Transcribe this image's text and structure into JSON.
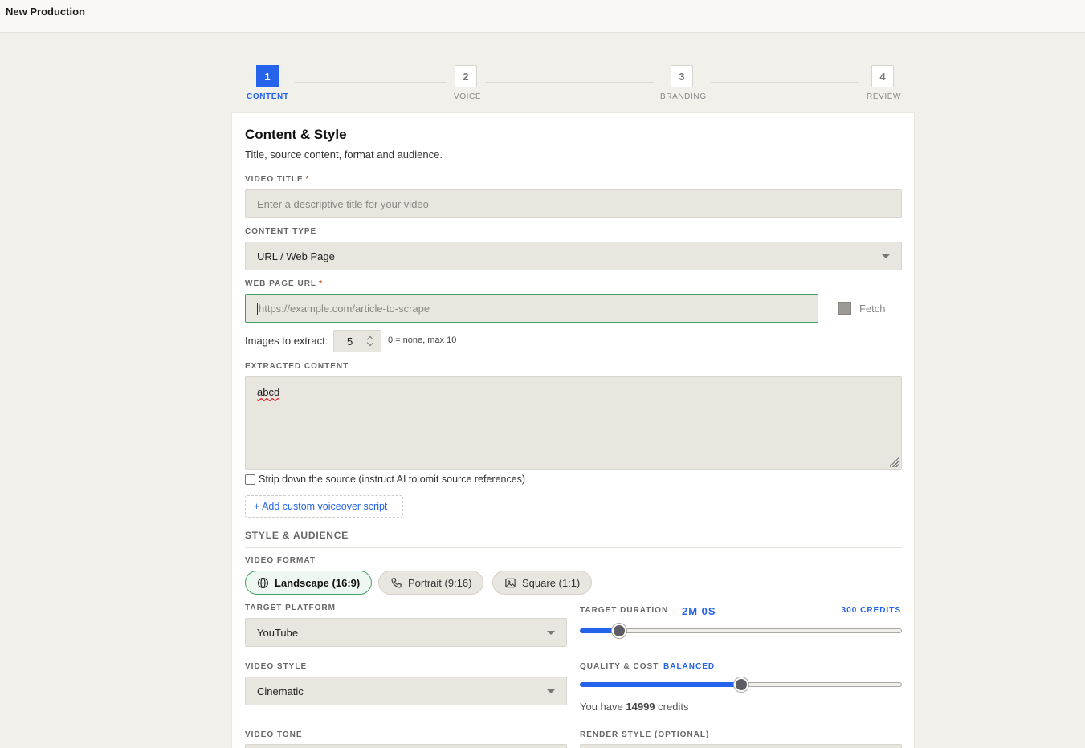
{
  "app": {
    "title": "New Production"
  },
  "stepper": {
    "steps": [
      {
        "number": "1",
        "label": "CONTENT"
      },
      {
        "number": "2",
        "label": "VOICE"
      },
      {
        "number": "3",
        "label": "BRANDING"
      },
      {
        "number": "4",
        "label": "REVIEW"
      }
    ],
    "active_index": 0
  },
  "content": {
    "heading": "Content & Style",
    "subheading": "Title, source content, format and audience.",
    "video_title": {
      "label": "VIDEO TITLE",
      "required_mark": "*",
      "value": "",
      "placeholder": "Enter a descriptive title for your video"
    },
    "content_type": {
      "label": "CONTENT TYPE",
      "value": "URL / Web Page"
    },
    "web_page_url": {
      "label": "WEB PAGE URL",
      "required_mark": "*",
      "value": "",
      "placeholder": "https://example.com/article-to-scrape",
      "fetch_label": "Fetch"
    },
    "images_to_extract": {
      "label": "Images to extract:",
      "value": "5",
      "hint": "0 = none, max 10"
    },
    "extracted_content": {
      "label": "EXTRACTED CONTENT",
      "value": "abcd"
    },
    "strip_source": {
      "label": "Strip down the source (instruct AI to omit source references)",
      "checked": false
    },
    "add_custom_script_label": "+ Add custom voiceover script"
  },
  "style": {
    "section_title": "STYLE & AUDIENCE",
    "video_format": {
      "label": "VIDEO FORMAT",
      "options": [
        {
          "label": "Landscape (16:9)",
          "icon": "globe-icon",
          "selected": true
        },
        {
          "label": "Portrait (9:16)",
          "icon": "phone-icon",
          "selected": false
        },
        {
          "label": "Square (1:1)",
          "icon": "image-icon",
          "selected": false
        }
      ]
    },
    "target_platform": {
      "label": "TARGET PLATFORM",
      "value": "YouTube"
    },
    "target_duration": {
      "label": "TARGET DURATION",
      "value": "2M 0S",
      "credits": "300 CREDITS",
      "slider_fraction": 0.12
    },
    "video_style": {
      "label": "VIDEO STYLE",
      "value": "Cinematic"
    },
    "quality_cost": {
      "label": "QUALITY & COST",
      "value": "BALANCED",
      "slider_fraction": 0.5
    },
    "credits_balance": {
      "prefix": "You have",
      "amount": "14999",
      "suffix": "credits"
    },
    "video_tone": {
      "label": "VIDEO TONE"
    },
    "render_style": {
      "label": "RENDER STYLE (OPTIONAL)"
    }
  },
  "colors": {
    "accent": "#2563eb",
    "focus": "#3da363",
    "required": "#d24b1e"
  }
}
